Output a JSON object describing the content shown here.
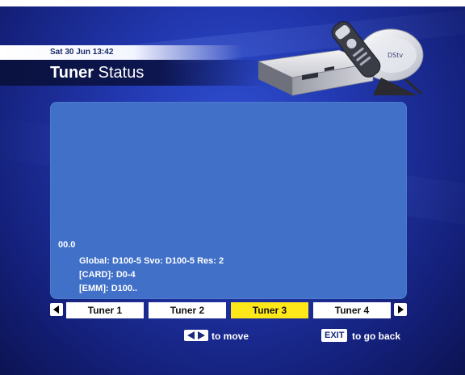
{
  "header": {
    "datetime": "Sat 30 Jun 13:42",
    "title_bold": "Tuner",
    "title_rest": " Status",
    "dish_brand": "DStv"
  },
  "status": {
    "line1": "00.0",
    "line2": "Global: D100-5 Svo: D100-5 Res: 2",
    "line3": "[CARD]: D0-4",
    "line4": "[EMM]: D100.."
  },
  "tabs": [
    {
      "label": "Tuner 1"
    },
    {
      "label": "Tuner 2"
    },
    {
      "label": "Tuner 3"
    },
    {
      "label": "Tuner 4"
    }
  ],
  "selected_tab": "Tuner 3",
  "footer": {
    "move_hint": "to move",
    "exit_key": "EXIT",
    "exit_hint": "to go back"
  },
  "colors": {
    "panel": "#4070c8",
    "active_tab": "#ffe81a",
    "background": "#2238b0"
  }
}
